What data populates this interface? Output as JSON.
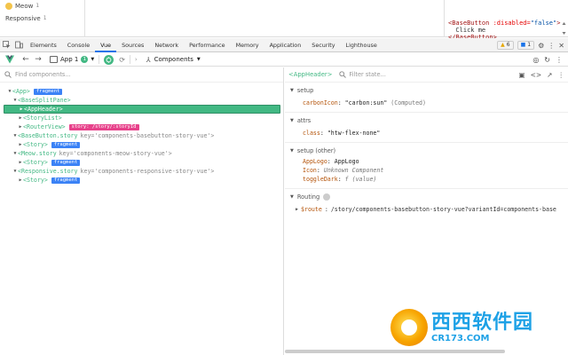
{
  "preview": {
    "items": [
      {
        "label": "Meow",
        "count": "1"
      },
      {
        "label": "Responsive",
        "count": "1"
      }
    ],
    "code_lines": [
      {
        "tag_open": "<BaseButton",
        "attr": " :disabled=",
        "val": "\"false\"",
        "tag_close": ">"
      },
      {
        "text": "  Click me"
      },
      {
        "tag_open": "</BaseButton>"
      }
    ]
  },
  "devtools": {
    "tabs": [
      "Elements",
      "Console",
      "Vue",
      "Sources",
      "Network",
      "Performance",
      "Memory",
      "Application",
      "Security",
      "Lighthouse"
    ],
    "active_tab": "Vue",
    "warnings": "6",
    "infos": "1"
  },
  "vue_toolbar": {
    "app_label": "App 1",
    "app_count": "1",
    "view_label": "Components"
  },
  "components_panel": {
    "search_placeholder": "Find components..."
  },
  "tree": [
    {
      "indent": 0,
      "arrow": "▼",
      "tag": "<App>",
      "badge": "fragment",
      "badge_type": "fragment"
    },
    {
      "indent": 1,
      "arrow": "▼",
      "tag": "<BaseSplitPane>"
    },
    {
      "indent": 2,
      "arrow": "▶",
      "tag": "<AppHeader>",
      "selected": true
    },
    {
      "indent": 2,
      "arrow": "▶",
      "tag": "<StoryList>"
    },
    {
      "indent": 2,
      "arrow": "▶",
      "tag": "<RouterView>",
      "badge": "story: /story/:storyId",
      "badge_type": "route"
    },
    {
      "indent": 1,
      "arrow": "▼",
      "tag": "<BaseButton.story",
      "key": "key=",
      "keyval": "'components-basebutton-story-vue'>"
    },
    {
      "indent": 2,
      "arrow": "▶",
      "tag": "<Story>",
      "badge": "fragment",
      "badge_type": "fragment"
    },
    {
      "indent": 1,
      "arrow": "▼",
      "tag": "<Meow.story",
      "key": "key=",
      "keyval": "'components-meow-story-vue'>"
    },
    {
      "indent": 2,
      "arrow": "▶",
      "tag": "<Story>",
      "badge": "fragment",
      "badge_type": "fragment"
    },
    {
      "indent": 1,
      "arrow": "▼",
      "tag": "<Responsive.story",
      "key": "key=",
      "keyval": "'components-responsive-story-vue'>"
    },
    {
      "indent": 2,
      "arrow": "▶",
      "tag": "<Story>",
      "badge": "fragment",
      "badge_type": "fragment"
    }
  ],
  "inspector": {
    "component": "<AppHeader>",
    "filter_placeholder": "Filter state...",
    "sections": {
      "setup": {
        "title": "setup",
        "props": [
          {
            "key": "carbonIcon",
            "value": "\"carbon:sun\"",
            "extra": "(Computed)"
          }
        ]
      },
      "attrs": {
        "title": "attrs",
        "props": [
          {
            "key": "class",
            "value": "\"htw-flex-none\""
          }
        ]
      },
      "setup_other": {
        "title": "setup (other)",
        "props": [
          {
            "key": "AppLogo",
            "value": "AppLogo"
          },
          {
            "key": "Icon",
            "value": "Unknown Component"
          },
          {
            "key": "toggleDark",
            "value": "f (value)"
          }
        ]
      },
      "routing": {
        "title": "Routing",
        "route_key": "$route",
        "route_value": "/story/components-basebutton-story-vue?variantId=components-base"
      }
    }
  },
  "watermark": {
    "brand": "西西软件园",
    "url": "CR173.COM"
  },
  "colors": {
    "vue_green": "#42b883",
    "fragment_blue": "#3b82f6",
    "route_pink": "#e7428b",
    "devtools_blue": "#1a73e8"
  }
}
